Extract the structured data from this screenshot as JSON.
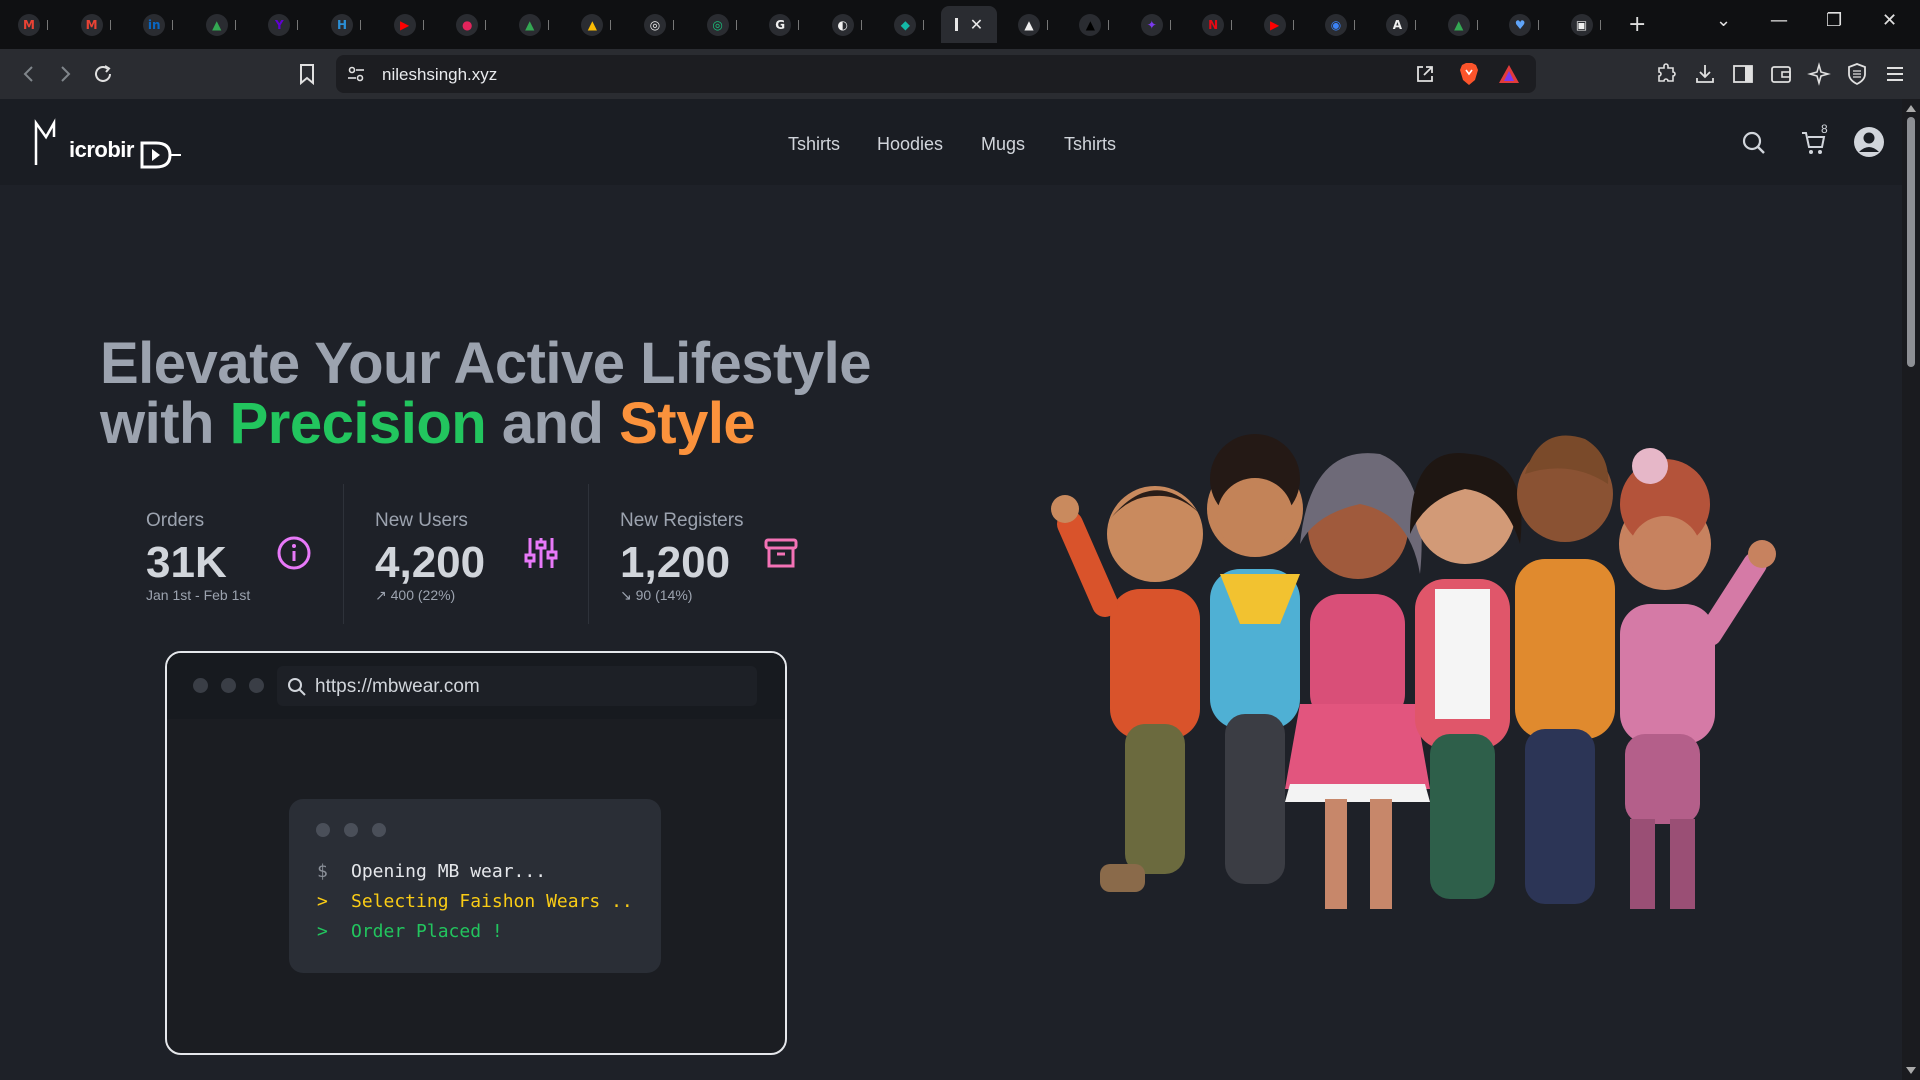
{
  "browser": {
    "tabs": [
      {
        "icon": "gmail-icon",
        "color": "#ea4335",
        "glyph": "M"
      },
      {
        "icon": "gmail-icon",
        "color": "#ea4335",
        "glyph": "M"
      },
      {
        "icon": "linkedin-icon",
        "color": "#0a66c2",
        "glyph": "in"
      },
      {
        "icon": "drive-icon",
        "color": "#34a853",
        "glyph": "▲"
      },
      {
        "icon": "yahoo-icon",
        "color": "#6001d2",
        "glyph": "Y"
      },
      {
        "icon": "app-icon",
        "color": "#2b8fd6",
        "glyph": "H"
      },
      {
        "icon": "youtube-icon",
        "color": "#ff0000",
        "glyph": "▶"
      },
      {
        "icon": "app-icon",
        "color": "#e3245c",
        "glyph": "●"
      },
      {
        "icon": "drive-icon",
        "color": "#34a853",
        "glyph": "▲"
      },
      {
        "icon": "drive-icon",
        "color": "#fbbc04",
        "glyph": "▲"
      },
      {
        "icon": "openai-icon",
        "color": "#f0f0f0",
        "glyph": "◎"
      },
      {
        "icon": "chatgpt-icon",
        "color": "#19c37d",
        "glyph": "◎"
      },
      {
        "icon": "grammarly-icon",
        "color": "#f0f0f0",
        "glyph": "G"
      },
      {
        "icon": "github-icon",
        "color": "#f0f0f0",
        "glyph": "◐"
      },
      {
        "icon": "app-icon",
        "color": "#14b8a6",
        "glyph": "◆"
      }
    ],
    "tabs_after": [
      {
        "icon": "vercel-icon",
        "color": "#f0f0f0",
        "glyph": "▲"
      },
      {
        "icon": "vercel-icon",
        "color": "#000000",
        "glyph": "▲"
      },
      {
        "icon": "app-icon",
        "color": "#7c3aed",
        "glyph": "✦"
      },
      {
        "icon": "netflix-icon",
        "color": "#e50914",
        "glyph": "N"
      },
      {
        "icon": "youtube-icon",
        "color": "#ff0000",
        "glyph": "▶"
      },
      {
        "icon": "app-icon",
        "color": "#3b82f6",
        "glyph": "◉"
      },
      {
        "icon": "app-icon",
        "color": "#f0f0f0",
        "glyph": "A"
      },
      {
        "icon": "drive-icon",
        "color": "#34a853",
        "glyph": "▲"
      },
      {
        "icon": "app-icon",
        "color": "#60a5fa",
        "glyph": "♥"
      },
      {
        "icon": "app-icon",
        "color": "#f0f0f0",
        "glyph": "▣"
      }
    ],
    "url": "nileshsingh.xyz"
  },
  "site": {
    "logo_text": "icrobir",
    "nav": [
      "Tshirts",
      "Hoodies",
      "Mugs",
      "Tshirts"
    ],
    "cart_count": "8"
  },
  "hero": {
    "line1": "Elevate Your Active Lifestyle",
    "line2_prefix": "with ",
    "highlight1": "Precision",
    "middle": " and ",
    "highlight2": "Style"
  },
  "stats": [
    {
      "title": "Orders",
      "value": "31K",
      "desc": "Jan 1st - Feb 1st",
      "icon": "info-icon",
      "color": "#e879f9"
    },
    {
      "title": "New Users",
      "value": "4,200",
      "desc": "↗︎ 400 (22%)",
      "icon": "sliders-icon",
      "color": "#e879f9"
    },
    {
      "title": "New Registers",
      "value": "1,200",
      "desc": "↘︎ 90 (14%)",
      "icon": "archive-icon",
      "color": "#f472b6"
    }
  ],
  "mockup": {
    "url": "https://mbwear.com",
    "terminal": [
      {
        "prefix": "$",
        "text": "Opening MB wear...",
        "color": "#e5e7eb"
      },
      {
        "prefix": ">",
        "text": "Selecting Faishon Wears ..",
        "color": "#facc15"
      },
      {
        "prefix": ">",
        "text": "Order Placed !",
        "color": "#22c55e"
      }
    ]
  },
  "colors": {
    "green": "#22c55e",
    "orange": "#fb923c",
    "accent_pink": "#e879f9"
  }
}
